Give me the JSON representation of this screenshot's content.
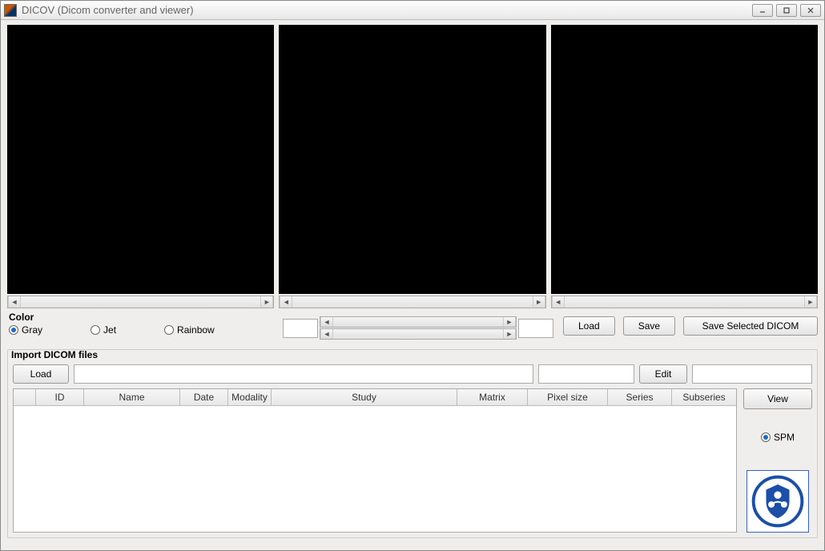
{
  "window": {
    "title": "DICOV (Dicom converter and viewer)"
  },
  "color": {
    "label": "Color",
    "options": {
      "gray": "Gray",
      "jet": "Jet",
      "rainbow": "Rainbow"
    },
    "selected": "gray"
  },
  "viewer_controls": {
    "left_value": "",
    "right_value": ""
  },
  "buttons": {
    "load": "Load",
    "save": "Save",
    "save_selected": "Save Selected DICOM",
    "import_load": "Load",
    "edit": "Edit",
    "view": "View"
  },
  "import": {
    "label": "Import DICOM files",
    "path_value": "",
    "field2_value": "",
    "field3_value": ""
  },
  "table": {
    "headers": {
      "blank": "",
      "id": "ID",
      "name": "Name",
      "date": "Date",
      "modality": "Modality",
      "study": "Study",
      "matrix": "Matrix",
      "pixel_size": "Pixel size",
      "series": "Series",
      "subseries": "Subseries"
    }
  },
  "modality_radio": {
    "spm": "SPM"
  }
}
